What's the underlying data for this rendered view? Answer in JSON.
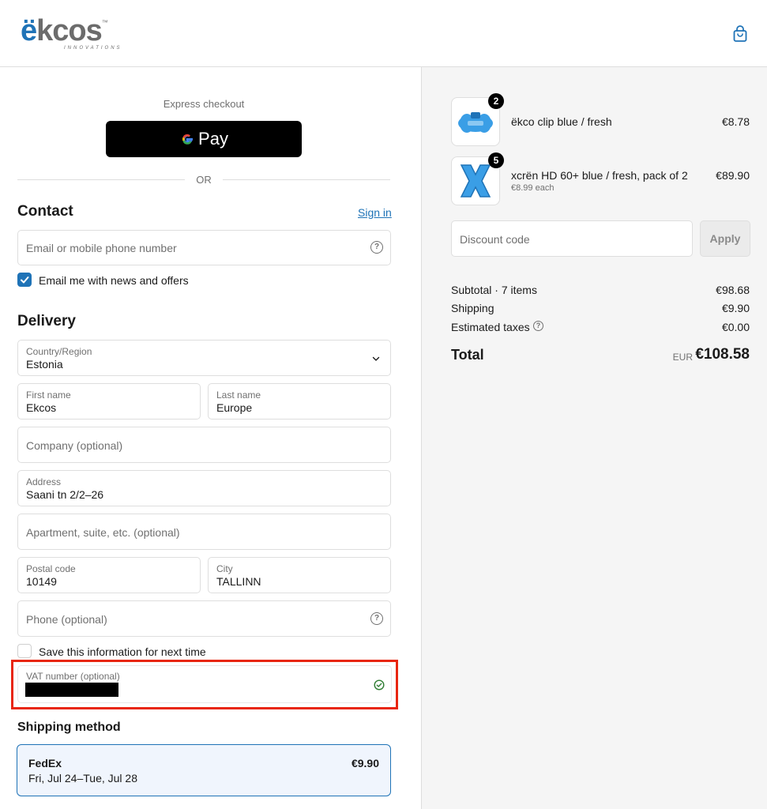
{
  "header": {
    "logo_main_first": "ë",
    "logo_main_rest": "kcos",
    "logo_tm": "™",
    "logo_sub": "INNOVATIONS",
    "cart_icon": "shopping-bag-icon"
  },
  "express": {
    "title": "Express checkout",
    "gpay_label": "Pay",
    "or": "OR"
  },
  "contact": {
    "heading": "Contact",
    "signin": "Sign in",
    "email_placeholder": "Email or mobile phone number",
    "news_label": "Email me with news and offers",
    "news_checked": true
  },
  "delivery": {
    "heading": "Delivery",
    "country_label": "Country/Region",
    "country_value": "Estonia",
    "first_name_label": "First name",
    "first_name_value": "Ekcos",
    "last_name_label": "Last name",
    "last_name_value": "Europe",
    "company_placeholder": "Company (optional)",
    "address_label": "Address",
    "address_value": "Saani tn 2/2–26",
    "apartment_placeholder": "Apartment, suite, etc. (optional)",
    "postal_label": "Postal code",
    "postal_value": "10149",
    "city_label": "City",
    "city_value": "TALLINN",
    "phone_placeholder": "Phone (optional)",
    "save_label": "Save this information for next time",
    "save_checked": false,
    "vat_label": "VAT number (optional)"
  },
  "shipping": {
    "heading": "Shipping method",
    "name": "FedEx",
    "dates": "Fri, Jul 24–Tue, Jul 28",
    "price": "€9.90"
  },
  "order": {
    "items": [
      {
        "name": "ëkco clip blue / fresh",
        "qty": "2",
        "price": "€8.78",
        "sub": ""
      },
      {
        "name": "xcrën HD 60+ blue / fresh, pack of 2",
        "qty": "5",
        "price": "€89.90",
        "sub": "€8.99 each"
      }
    ],
    "discount_placeholder": "Discount code",
    "apply": "Apply",
    "subtotal_label": "Subtotal · 7 items",
    "subtotal": "€98.68",
    "shipping_label": "Shipping",
    "shipping": "€9.90",
    "taxes_label": "Estimated taxes",
    "taxes": "€0.00",
    "total_label": "Total",
    "currency": "EUR",
    "total": "€108.58"
  },
  "colors": {
    "accent": "#1f73b7",
    "highlight": "#e8260f",
    "summary_bg": "#f5f5f5"
  }
}
